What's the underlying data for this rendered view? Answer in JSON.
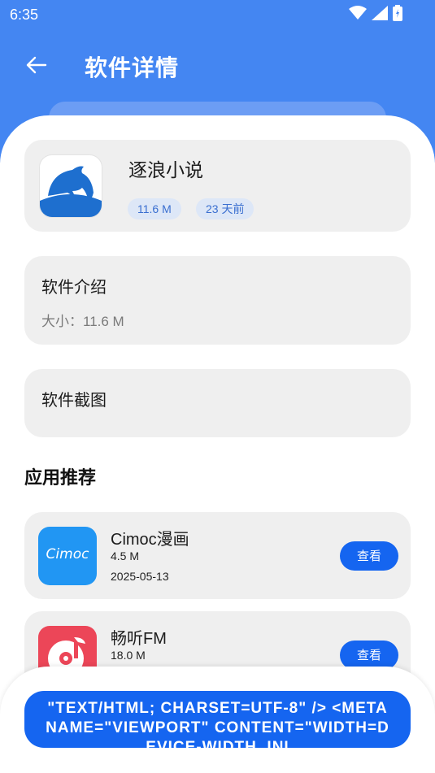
{
  "status_bar": {
    "time": "6:35"
  },
  "header": {
    "title": "软件详情"
  },
  "app": {
    "name": "逐浪小说",
    "size_chip": "11.6 M",
    "date_chip": "23 天前"
  },
  "intro": {
    "title": "软件介绍",
    "size_text": "大小：11.6 M"
  },
  "screenshots": {
    "title": "软件截图"
  },
  "recommend": {
    "heading": "应用推荐",
    "items": [
      {
        "name": "Cimoc漫画",
        "size": "4.5 M",
        "date": "2025-05-13",
        "icon_text": "Cimoc",
        "button": "查看"
      },
      {
        "name": "畅听FM",
        "size": "18.0 M",
        "button": "查看"
      }
    ]
  },
  "download_button": {
    "label": "\"TEXT/HTML; CHARSET=UTF-8\" /> <META NAME=\"VIEWPORT\" CONTENT=\"WIDTH=DEVICE-WIDTH, INI"
  },
  "colors": {
    "header_blue": "#4486f2",
    "button_blue": "#1565f0",
    "card_gray": "#efefef",
    "chip_bg": "#dde7f7"
  }
}
